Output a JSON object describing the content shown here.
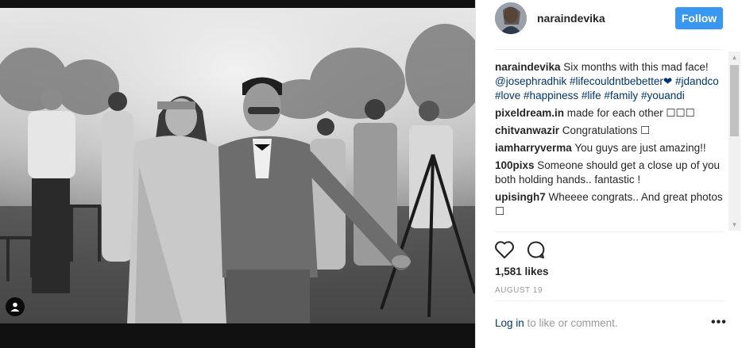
{
  "post": {
    "username": "naraindevika",
    "follow_label": "Follow",
    "caption": {
      "user": "naraindevika",
      "text": " Six months with this mad face! ",
      "mention": "@josephradhik",
      "tags": [
        "#lifecouldntbebetter❤",
        "#jdandco",
        "#love",
        "#happiness",
        "#life",
        "#family",
        "#youandi"
      ]
    },
    "comments": [
      {
        "user": "pixeldream.in",
        "text": " made for each other ☐☐☐"
      },
      {
        "user": "chitvanwazir",
        "text": " Congratulations ☐"
      },
      {
        "user": "iamharryverma",
        "text": " You guys are just amazing!!"
      },
      {
        "user": "100pixs",
        "text": " Someone should get a close up of you both holding hands.. fantastic !"
      },
      {
        "user": "upisingh7",
        "text": " Wheeee congrats.. And great photos ☐"
      }
    ],
    "likes": "1,581 likes",
    "date": "AUGUST 19",
    "login_link": "Log in",
    "login_text": " to like or comment.",
    "more_label": "•••"
  },
  "icons": {
    "like": "heart-icon",
    "comment": "comment-bubble-icon",
    "user_tag": "person-icon",
    "options": "more-options-icon"
  },
  "colors": {
    "follow_button": "#3897f0",
    "link": "#003569",
    "text": "#262626",
    "muted": "#999999"
  }
}
